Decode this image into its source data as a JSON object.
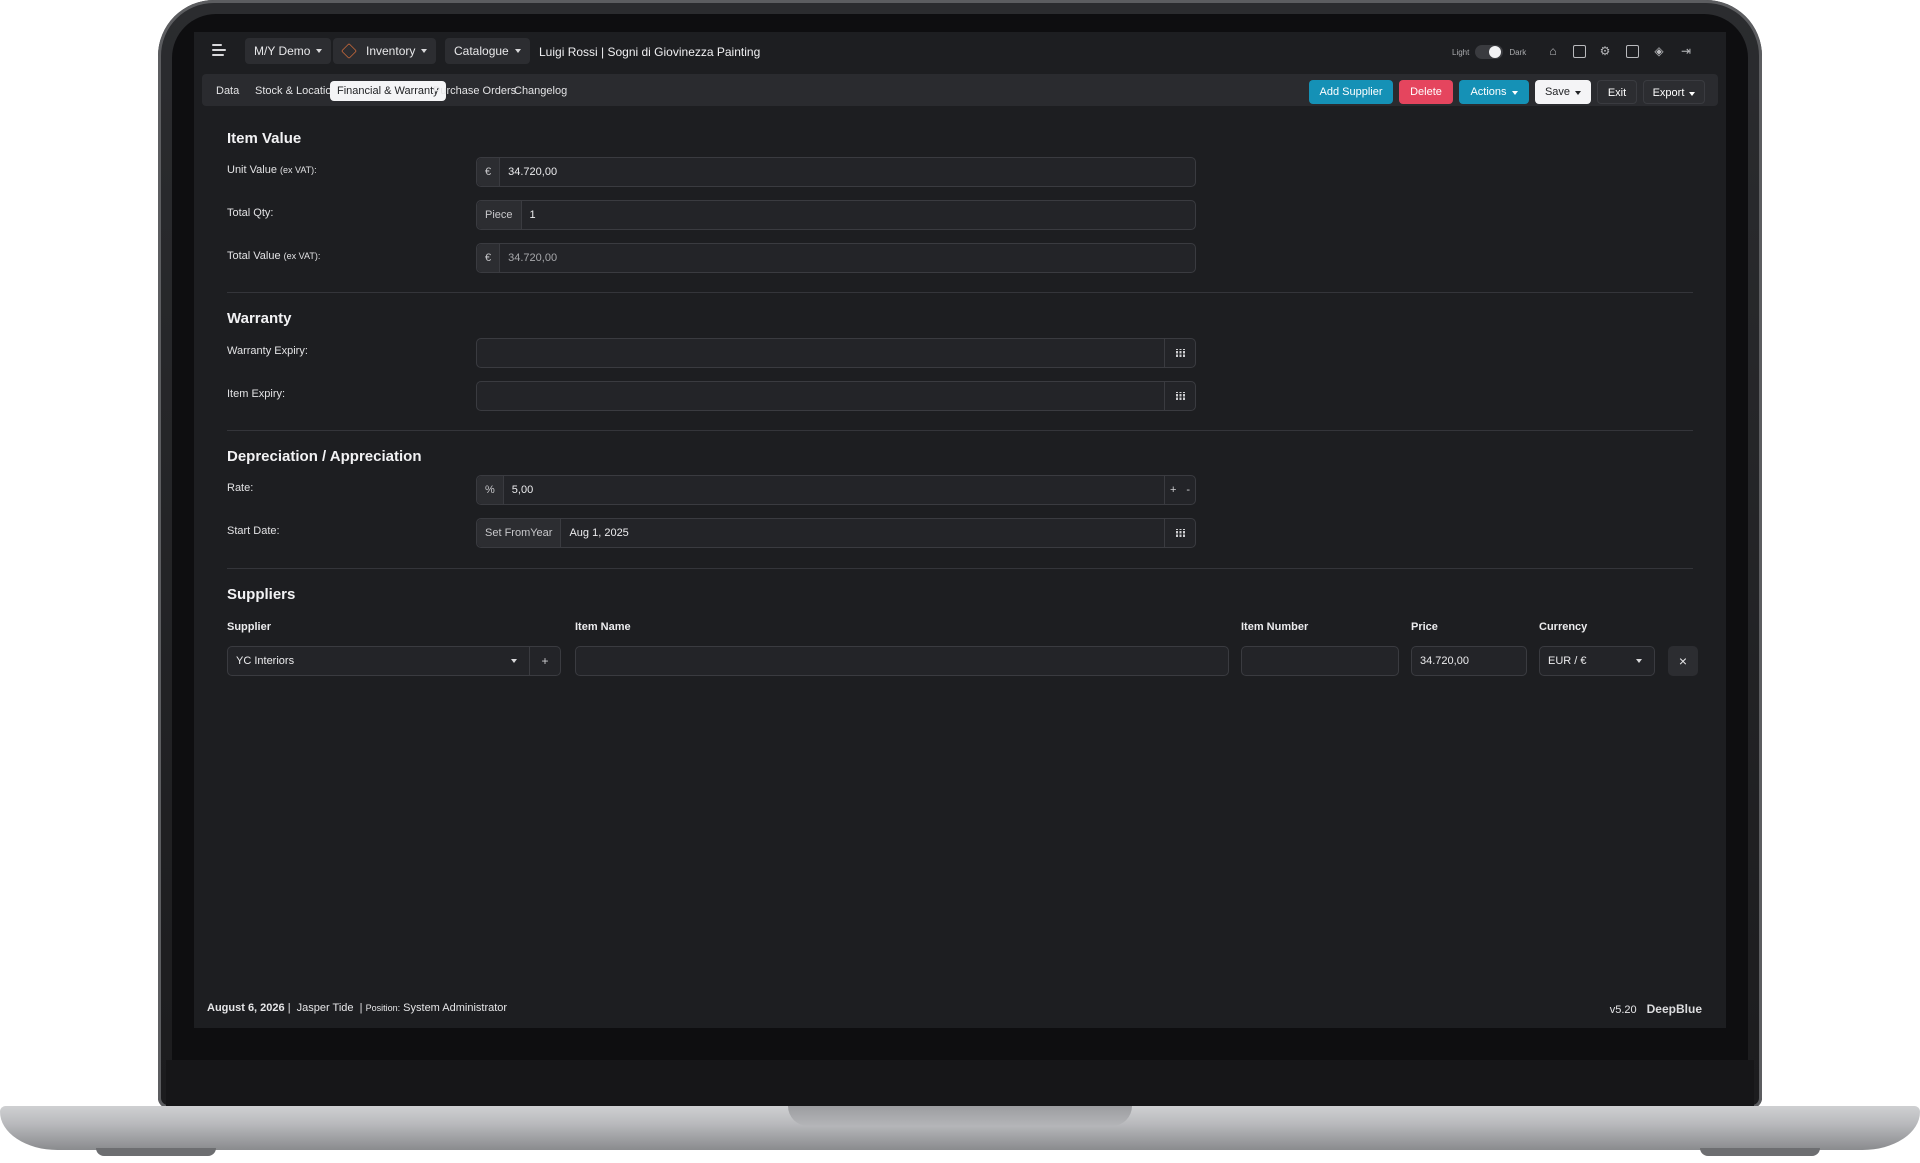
{
  "topbar": {
    "vessel": "M/Y Demo",
    "module": "Inventory",
    "section": "Catalogue",
    "breadcrumb": "Luigi Rossi | Sogni di Giovinezza Painting",
    "theme_light": "Light",
    "theme_dark": "Dark",
    "theme_mode": "dark"
  },
  "tabs": [
    "Data",
    "Stock & Locations",
    "Financial & Warranty",
    "Purchase Orders",
    "Changelog"
  ],
  "active_tab": "Financial & Warranty",
  "actions": {
    "add_supplier": "Add Supplier",
    "delete": "Delete",
    "actions": "Actions",
    "save": "Save",
    "exit": "Exit",
    "export": "Export"
  },
  "item_value": {
    "title": "Item Value",
    "unit_value_label": "Unit Value",
    "unit_value_suffix": "(ex VAT):",
    "unit_value": "34.720,00",
    "total_qty_label": "Total Qty:",
    "qty_unit": "Piece",
    "total_qty": "1",
    "total_value_label": "Total Value",
    "total_value_suffix": "(ex VAT):",
    "total_value": "34.720,00",
    "currency_symbol": "€"
  },
  "warranty": {
    "title": "Warranty",
    "warranty_expiry_label": "Warranty Expiry:",
    "warranty_expiry": "",
    "item_expiry_label": "Item Expiry:",
    "item_expiry": ""
  },
  "depreciation": {
    "title": "Depreciation / Appreciation",
    "rate_label": "Rate:",
    "rate_addon": "%",
    "rate": "5,00",
    "plus": "+",
    "minus": "-",
    "start_date_label": "Start Date:",
    "set_from_year": "Set FromYear",
    "start_date": "Aug 1, 2025"
  },
  "suppliers": {
    "title": "Suppliers",
    "columns": [
      "Supplier",
      "Item Name",
      "Item Number",
      "Price",
      "Currency"
    ],
    "rows": [
      {
        "supplier": "YC Interiors",
        "item_name": "",
        "item_number": "",
        "price": "34.720,00",
        "currency": "EUR / €"
      }
    ],
    "add": "+",
    "remove": "×"
  },
  "footer": {
    "date": "August 6, 2026",
    "user": "Jasper Tide",
    "position_label": "Position:",
    "position": "System Administrator",
    "version": "v5.20",
    "brand": "DeepBlue"
  },
  "colors": {
    "add_supplier": "#1591b6",
    "delete": "#e5455e",
    "actions": "#1591b6",
    "background": "#1d1e21"
  }
}
